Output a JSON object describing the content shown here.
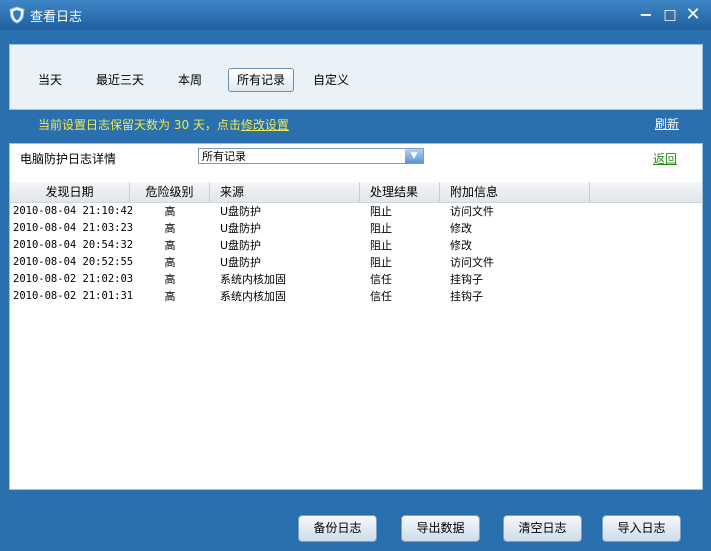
{
  "window": {
    "title": "查看日志",
    "minimize": "−",
    "maximize": "□",
    "close": "✕"
  },
  "tabs": [
    {
      "label": "当天"
    },
    {
      "label": "最近三天"
    },
    {
      "label": "本周"
    },
    {
      "label": "所有记录",
      "active": true
    },
    {
      "label": "自定义"
    }
  ],
  "notice": {
    "text": "当前设置日志保留天数为 30 天，点击",
    "link": "修改设置"
  },
  "refresh_label": "刷新",
  "detail": {
    "label": "电脑防护日志详情",
    "filter_value": "所有记录",
    "back_label": "返回"
  },
  "table": {
    "columns": [
      "发现日期",
      "危险级别",
      "来源",
      "处理结果",
      "附加信息"
    ],
    "rows": [
      {
        "date": "2010-08-04 21:10:42",
        "level": "高",
        "source": "U盘防护",
        "result": "阻止",
        "info": "访问文件"
      },
      {
        "date": "2010-08-04 21:03:23",
        "level": "高",
        "source": "U盘防护",
        "result": "阻止",
        "info": "修改"
      },
      {
        "date": "2010-08-04 20:54:32",
        "level": "高",
        "source": "U盘防护",
        "result": "阻止",
        "info": "修改"
      },
      {
        "date": "2010-08-04 20:52:55",
        "level": "高",
        "source": "U盘防护",
        "result": "阻止",
        "info": "访问文件"
      },
      {
        "date": "2010-08-02 21:02:03",
        "level": "高",
        "source": "系统内核加固",
        "result": "信任",
        "info": "挂钩子"
      },
      {
        "date": "2010-08-02 21:01:31",
        "level": "高",
        "source": "系统内核加固",
        "result": "信任",
        "info": "挂钩子"
      }
    ]
  },
  "buttons": {
    "backup": "备份日志",
    "export": "导出数据",
    "clear": "清空日志",
    "import": "导入日志"
  },
  "colors": {
    "titlebar": "#2a6fae",
    "notice": "#f0ea52",
    "back_link": "#2b8a1a"
  }
}
